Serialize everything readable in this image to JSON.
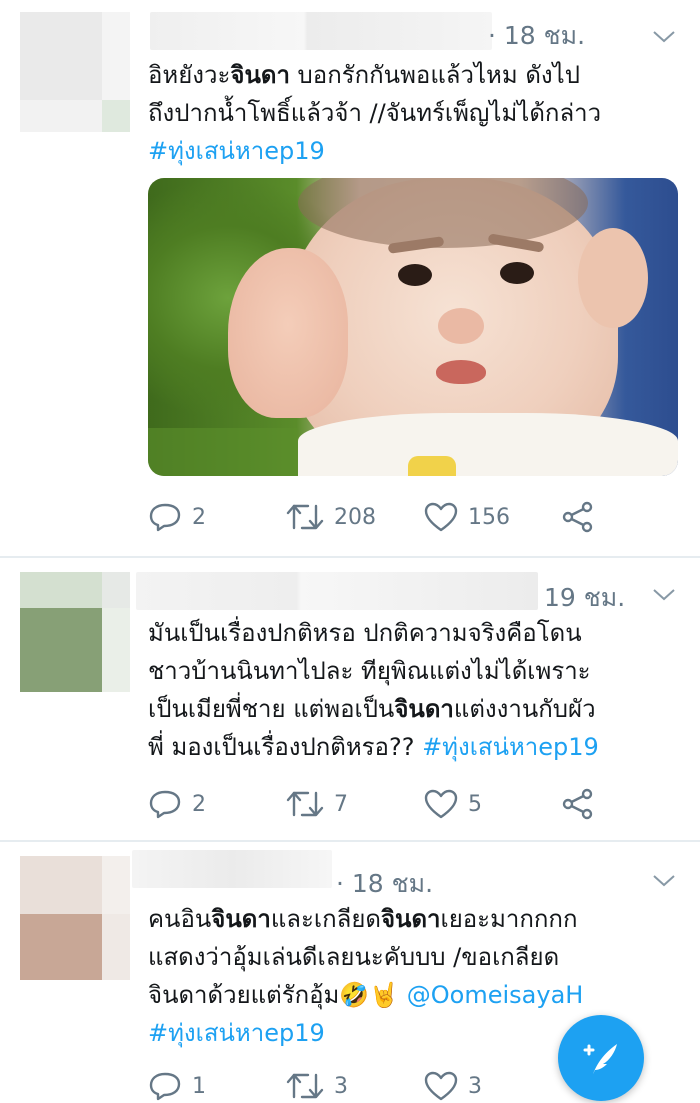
{
  "tweets": [
    {
      "timestamp": "· 18 ชม.",
      "text_line1_a": "อิหยังวะ",
      "text_line1_b": "จินดา",
      "text_line1_c": " บอกรักกันพอแล้วไหม ดังไป",
      "text_line2": "ถึงปากน้ำโพธิ์แล้วจ้า //จันทร์เพ็ญไม่ได้กล่าว",
      "hashtag": "#ทุ่งเสน่หาep19",
      "replies": "2",
      "retweets": "208",
      "likes": "156"
    },
    {
      "timestamp": "19 ชม.",
      "text_line1": "มันเป็นเรื่องปกติหรอ ปกติความจริงคือโดน",
      "text_line2": "ชาวบ้านนินทาไปละ ทียุพิณแต่งไม่ได้เพราะ",
      "text_line3_a": "เป็นเมียพี่ชาย แต่พอเป็น",
      "text_line3_b": "จินดา",
      "text_line3_c": "แต่งงานกับผัว",
      "text_line4": "พี่ มองเป็นเรื่องปกติหรอ?? ",
      "hashtag": "#ทุ่งเสน่หาep19",
      "replies": "2",
      "retweets": "7",
      "likes": "5"
    },
    {
      "timestamp": "· 18 ชม.",
      "text_line1_a": "คนอิน",
      "text_line1_b": "จินดา",
      "text_line1_c": "และเกลียด",
      "text_line1_d": "จินดา",
      "text_line1_e": "เยอะมากกกก",
      "text_line2": "แสดงว่าอุ้มเล่นดีเลยนะคับบบ /ขอเกลียด",
      "text_line3": "จินดาด้วยแต่รักอุ้ม🤣🤘 ",
      "mention": "@OomeisayaH",
      "hashtag": "#ทุ่งเสน่หาep19",
      "replies": "1",
      "retweets": "3",
      "likes": "3"
    }
  ],
  "icons": {
    "reply": "reply-icon",
    "retweet": "retweet-icon",
    "like": "heart-icon",
    "share": "share-icon",
    "compose": "compose-tweet-icon",
    "menu": "chevron-down-icon"
  },
  "colors": {
    "accent": "#1da1f2",
    "muted": "#657786",
    "text": "#14171a",
    "divider": "#e6ecf0"
  }
}
